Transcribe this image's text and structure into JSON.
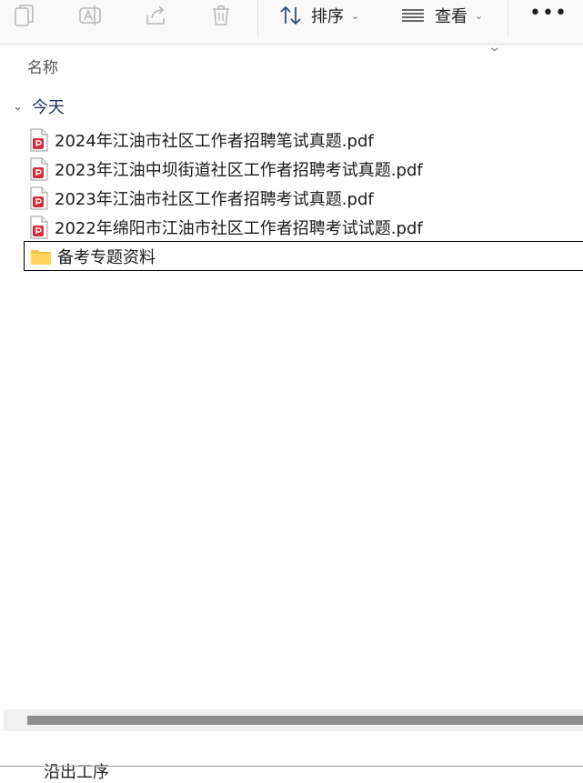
{
  "toolbar": {
    "icons": [
      "copy-icon",
      "rename-icon",
      "share-icon",
      "delete-icon"
    ],
    "sort_label": "排序",
    "view_label": "查看",
    "more_label": "•••"
  },
  "column": {
    "name_header": "名称"
  },
  "group": {
    "label": "今天"
  },
  "files": [
    {
      "name": "2024年江油市社区工作者招聘笔试真题.pdf",
      "icon": "pdf-icon"
    },
    {
      "name": "2023年江油中坝街道社区工作者招聘考试真题.pdf",
      "icon": "pdf-icon"
    },
    {
      "name": "2023年江油市社区工作者招聘考试真题.pdf",
      "icon": "pdf-icon"
    },
    {
      "name": "2022年绵阳市江油市社区工作者招聘考试试题.pdf",
      "icon": "pdf-icon"
    },
    {
      "name": "备考专题资料",
      "icon": "folder-icon"
    }
  ],
  "footer": {
    "cut_text": "沿出工序"
  }
}
